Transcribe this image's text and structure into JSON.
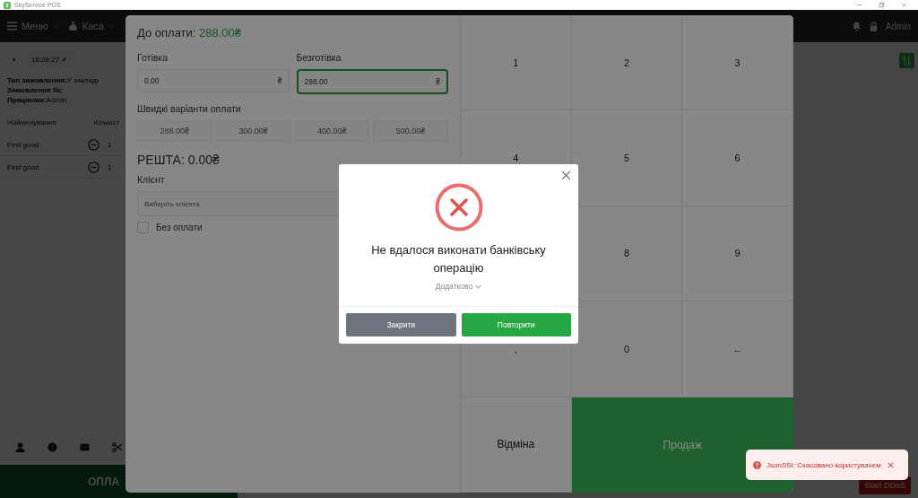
{
  "window": {
    "title": "SkyService POS"
  },
  "top_bar": {
    "menus": [
      {
        "label": "Меню",
        "kind": "menu"
      },
      {
        "label": "Каса",
        "kind": "cash"
      }
    ],
    "user": "Admin"
  },
  "order": {
    "time": "16:28:27",
    "info": [
      {
        "label": "Тип замовлення:",
        "value": "У закладі"
      },
      {
        "label": "Замовлення №:"
      },
      {
        "label": "Працівник:",
        "value": "Admin"
      }
    ],
    "columns": [
      "Найменування",
      "Кількіст"
    ],
    "items": [
      {
        "name": "First good",
        "quantity": "1"
      },
      {
        "name": "First good",
        "quantity": "1"
      }
    ],
    "pay_button": "ОПЛА"
  },
  "start_button": "Start DDoS",
  "payment": {
    "due_label": "До оплати:",
    "due_value": "288.00₴",
    "fields": [
      {
        "label": "Готівка",
        "value": "0.00",
        "currency": "₴",
        "focused": false
      },
      {
        "label": "Безготівка",
        "value": "288.00",
        "currency": "₴",
        "focused": true
      }
    ],
    "quick_label": "Швидкі варіанти оплати",
    "quick_options": [
      "288.00₴",
      "300.00₴",
      "400.00₴",
      "500.00₴"
    ],
    "change": "РЕШТА: 0.00₴",
    "client": {
      "label": "Клієнт",
      "placeholder": "Виберіть клієнта"
    },
    "no_payment": {
      "label": "Без оплати",
      "checked": false
    },
    "keys": [
      {
        "kind": "digit",
        "label": "1"
      },
      {
        "kind": "digit",
        "label": "2"
      },
      {
        "kind": "digit",
        "label": "3"
      },
      {
        "kind": "digit",
        "label": "4"
      },
      {
        "kind": "digit",
        "label": "5"
      },
      {
        "kind": "digit",
        "label": "6"
      },
      {
        "kind": "digit"
      },
      {
        "kind": "digit",
        "label": "8"
      },
      {
        "kind": "digit",
        "label": "9"
      },
      {
        "kind": "digit",
        "label": ","
      },
      {
        "kind": "digit",
        "label": "0"
      },
      {
        "kind": "backspace",
        "label": "←"
      },
      {
        "kind": "cancel",
        "label": "Відміна"
      },
      {
        "kind": "sell",
        "label": "Продаж"
      }
    ]
  },
  "dialog": {
    "message": "Не вдалося виконати банківську операцію",
    "details": "Додатково",
    "buttons": [
      {
        "label": "Закрити",
        "kind": "secondary"
      },
      {
        "label": "Повторити",
        "kind": "primary"
      }
    ]
  },
  "toast": {
    "message": "JsonSSI: Скасовано користувачем"
  }
}
